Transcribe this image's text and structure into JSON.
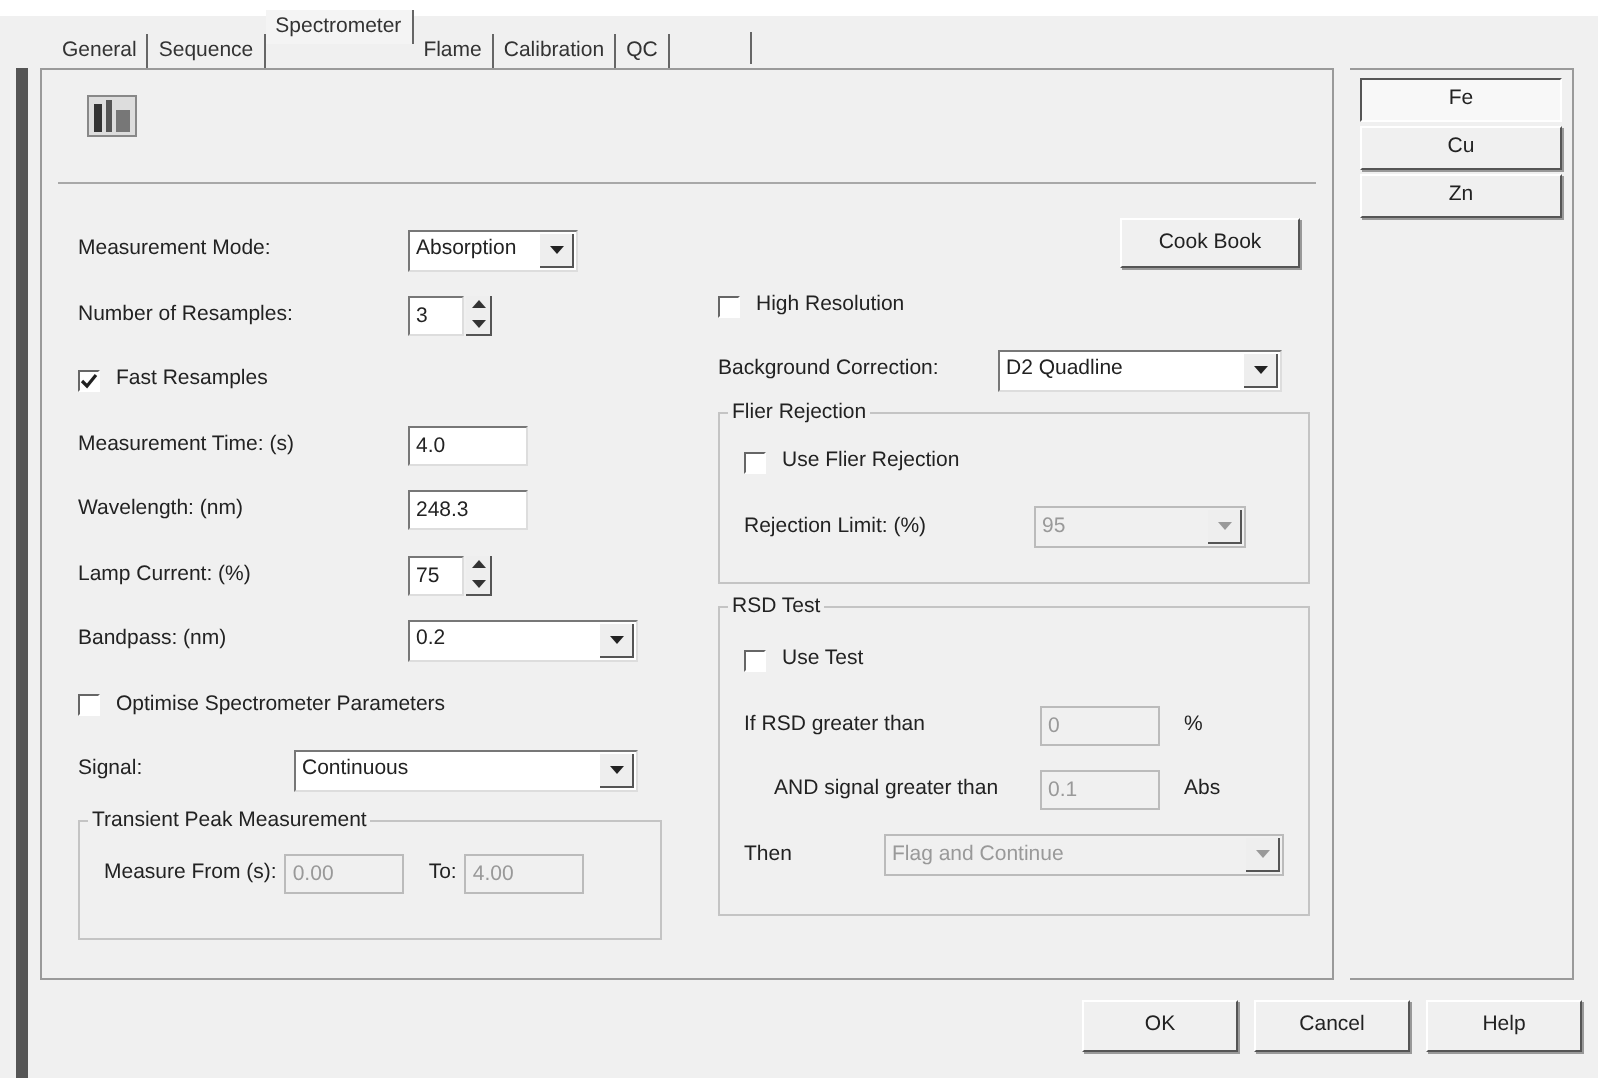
{
  "tabs": [
    {
      "label": "General",
      "selected": false
    },
    {
      "label": "Sequence",
      "selected": false
    },
    {
      "label": "Spectrometer",
      "selected": true
    },
    {
      "label": "Flame",
      "selected": false
    },
    {
      "label": "Calibration",
      "selected": false
    },
    {
      "label": "QC",
      "selected": false
    }
  ],
  "left_rows": [
    {
      "kind": "dropdown",
      "label": "Measurement Mode:",
      "value": "Absorption",
      "disabled": false
    },
    {
      "kind": "spin",
      "label": "Number of Resamples:",
      "value": "3",
      "disabled": false
    },
    {
      "kind": "checkbox",
      "label": "Fast Resamples",
      "checked": true
    },
    {
      "kind": "text",
      "label": "Measurement Time: (s)",
      "value": "4.0",
      "disabled": false
    },
    {
      "kind": "text",
      "label": "Wavelength: (nm)",
      "value": "248.3",
      "disabled": false
    },
    {
      "kind": "spin",
      "label": "Lamp Current: (%)",
      "value": "75",
      "disabled": false
    },
    {
      "kind": "dropdown",
      "label": "Bandpass: (nm)",
      "value": "0.2",
      "disabled": false
    },
    {
      "kind": "checkbox",
      "label": "Optimise Spectrometer Parameters",
      "checked": false
    },
    {
      "kind": "dropdown",
      "label": "Signal:",
      "value": "Continuous",
      "disabled": false
    }
  ],
  "transient": {
    "title": "Transient Peak Measurement",
    "fields": [
      {
        "label": "Measure From (s):",
        "value": "0.00",
        "disabled": true
      },
      {
        "label": "To:",
        "value": "4.00",
        "disabled": true
      }
    ]
  },
  "cook_book_button": "Cook Book",
  "high_resolution": {
    "label": "High Resolution",
    "checked": false
  },
  "background_correction": {
    "label": "Background Correction:",
    "value": "D2 Quadline",
    "disabled": false
  },
  "flier_rejection": {
    "title": "Flier Rejection",
    "use": {
      "label": "Use Flier Rejection",
      "checked": false
    },
    "limit": {
      "label": "Rejection Limit: (%)",
      "value": "95",
      "disabled": true
    }
  },
  "rsd_test": {
    "title": "RSD Test",
    "use": {
      "label": "Use Test",
      "checked": false
    },
    "rsd": {
      "label": "If RSD greater than",
      "value": "0",
      "unit": "%",
      "disabled": true
    },
    "signal": {
      "label": "AND signal greater than",
      "value": "0.1",
      "unit": "Abs",
      "disabled": true
    },
    "then": {
      "label": "Then",
      "value": "Flag and Continue",
      "disabled": true
    }
  },
  "elements": [
    {
      "label": "Fe",
      "selected": true
    },
    {
      "label": "Cu",
      "selected": false
    },
    {
      "label": "Zn",
      "selected": false
    }
  ],
  "buttons": [
    "OK",
    "Cancel",
    "Help"
  ]
}
